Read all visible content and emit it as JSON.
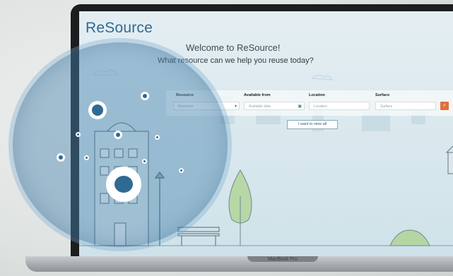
{
  "app": {
    "brand": "ReSource",
    "welcome": "Welcome to ReSource!",
    "subtitle": "What resource can we help you reuse today?"
  },
  "search": {
    "fields": [
      {
        "label": "Resource",
        "placeholder": "Resource",
        "icon": "chevron-down-icon"
      },
      {
        "label": "Available from",
        "placeholder": "Available date",
        "icon": "calendar-icon"
      },
      {
        "label": "Location",
        "placeholder": "Location",
        "icon": ""
      },
      {
        "label": "Surface",
        "placeholder": "Surface",
        "icon": ""
      }
    ],
    "search_icon": "search-icon",
    "view_all": "I want to view all"
  },
  "device": {
    "model": "MacBook Pro"
  },
  "colors": {
    "brand": "#2f6a91",
    "accent": "#e0703a",
    "overlay": "#4a86b0"
  }
}
